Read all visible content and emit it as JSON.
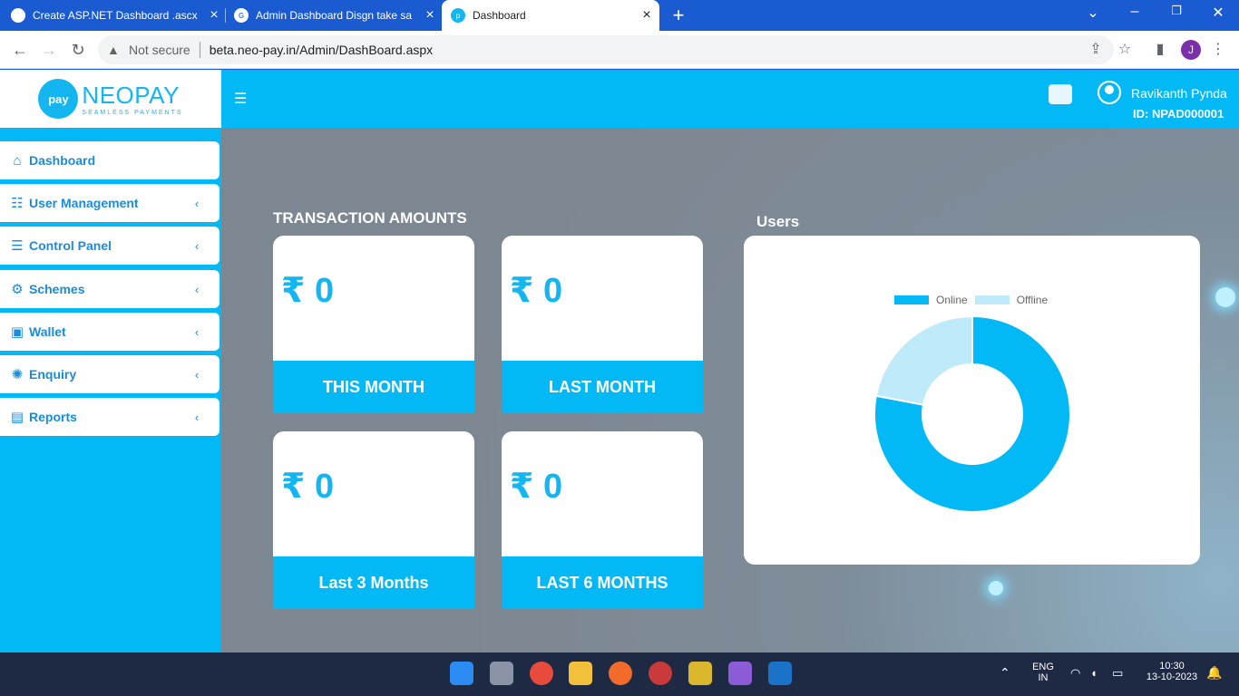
{
  "browser": {
    "tabs": [
      {
        "title": "Create ASP.NET Dashboard .ascx",
        "active": false
      },
      {
        "title": "Admin Dashboard Disgn take sa",
        "active": false
      },
      {
        "title": "Dashboard",
        "active": true
      }
    ],
    "security_label": "Not secure",
    "url": "beta.neo-pay.in/Admin/DashBoard.aspx",
    "profile_initial": "J"
  },
  "brand": {
    "name": "NEOPAY",
    "tagline": "SEAMLESS PAYMENTS",
    "logo_text": "pay"
  },
  "topbar": {
    "user_name": "Ravikanth Pynda",
    "user_id": "ID: NPAD000001"
  },
  "sidebar": {
    "items": [
      {
        "label": "Dashboard",
        "icon": "home-icon",
        "chevron": ""
      },
      {
        "label": "User Management",
        "icon": "users-icon",
        "chevron": "‹"
      },
      {
        "label": "Control Panel",
        "icon": "sliders-icon",
        "chevron": "‹"
      },
      {
        "label": "Schemes",
        "icon": "gear-icon",
        "chevron": "‹"
      },
      {
        "label": "Wallet",
        "icon": "wallet-icon",
        "chevron": "‹"
      },
      {
        "label": "Enquiry",
        "icon": "enquiry-icon",
        "chevron": "‹"
      },
      {
        "label": "Reports",
        "icon": "clipboard-icon",
        "chevron": "‹"
      }
    ]
  },
  "main": {
    "transaction_title": "TRANSACTION AMOUNTS",
    "users_title": "Users",
    "cards": [
      {
        "amount": "₹ 0",
        "caption": "THIS MONTH"
      },
      {
        "amount": "₹ 0",
        "caption": "LAST MONTH"
      },
      {
        "amount": "₹ 0",
        "caption": "Last 3 Months"
      },
      {
        "amount": "₹ 0",
        "caption": "LAST 6 MONTHS"
      }
    ]
  },
  "chart_data": {
    "type": "pie",
    "title": "Users",
    "categories": [
      "Online",
      "Offline"
    ],
    "values": [
      78,
      22
    ],
    "colors": [
      "#03b9f5",
      "#bfeaf9"
    ],
    "donut": true,
    "legend": "top"
  },
  "taskbar": {
    "lang": "ENG",
    "region": "IN",
    "time": "10:30",
    "date": "13-10-2023"
  }
}
